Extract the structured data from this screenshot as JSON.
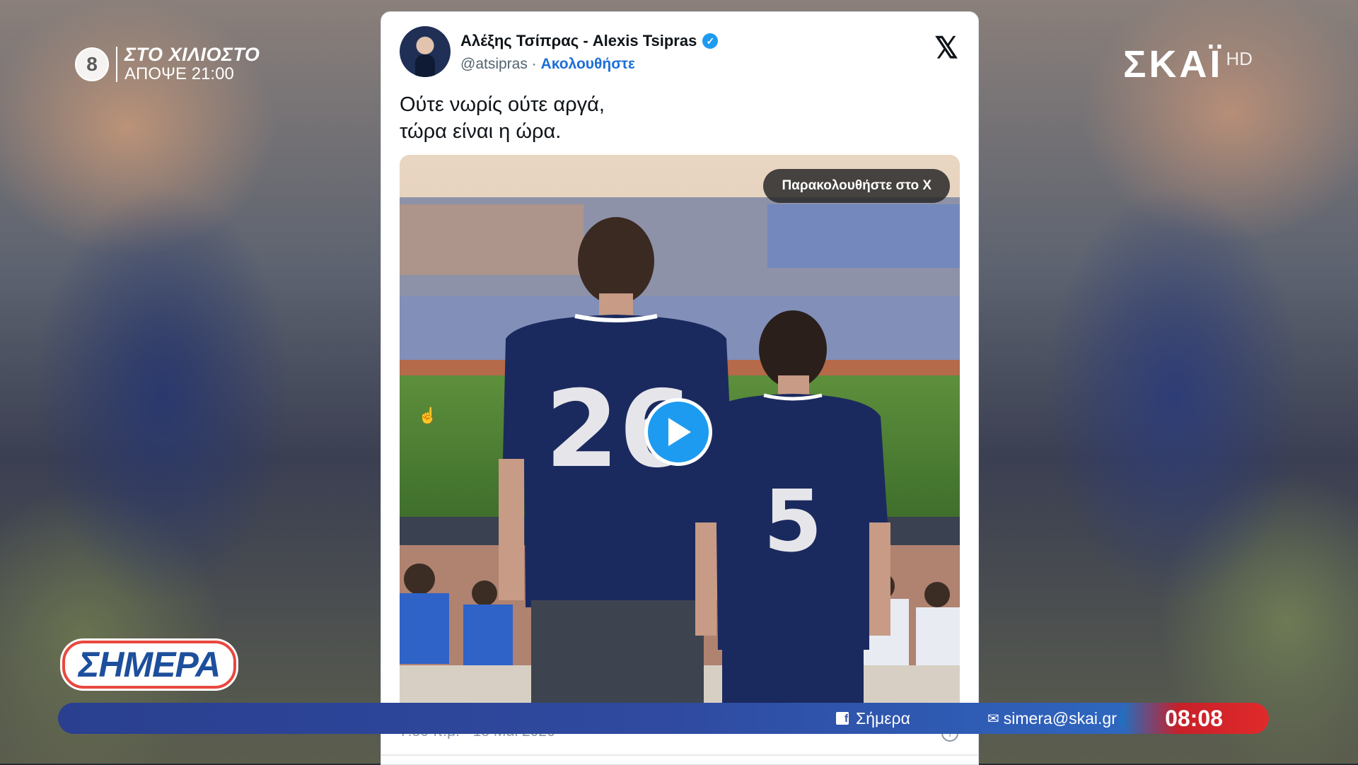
{
  "promo": {
    "channel_number": "8",
    "title": "ΣΤΟ ΧΙΛΙΟΣΤΟ",
    "time": "ΑΠΟΨΕ 21:00"
  },
  "channel": {
    "name": "ΣΚΑΪ",
    "quality": "HD"
  },
  "tweet": {
    "author": "Αλέξης Τσίπρας - Alexis Tsipras",
    "handle": "@atsipras",
    "separator": " · ",
    "follow_label": "Ακολουθήστε",
    "text_line1": "Ούτε νωρίς ούτε αργά,",
    "text_line2": "τώρα είναι η ώρα.",
    "watch_label": "Παρακολουθήστε στο X",
    "date": "7:30 π.μ. · 18 Μαΐ 2026",
    "jersey_left": "26",
    "jersey_right": "5"
  },
  "show": {
    "logo_text": "ΣΗΜΕΡΑ"
  },
  "ticker": {
    "facebook_label": "Σήμερα",
    "email": "simera@skai.gr",
    "clock": "08:08"
  },
  "colors": {
    "x_blue": "#1d9bf0",
    "ticker_blue": "#2f4aa0",
    "clock_red": "#e02a2a"
  }
}
